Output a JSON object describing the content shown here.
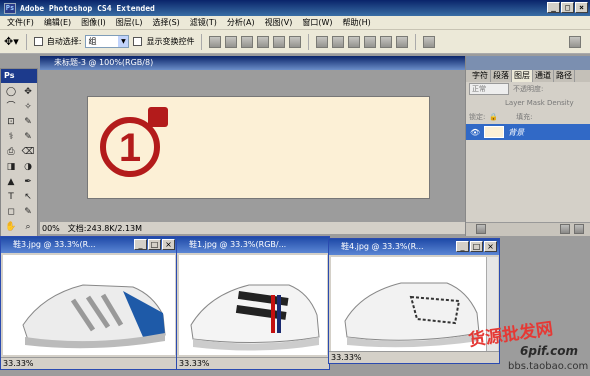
{
  "app": {
    "title": "Adobe Photoshop CS4 Extended",
    "ps_badge": "Ps"
  },
  "menu": [
    "文件(F)",
    "编辑(E)",
    "图像(I)",
    "图层(L)",
    "选择(S)",
    "滤镜(T)",
    "分析(A)",
    "视图(V)",
    "窗口(W)",
    "帮助(H)"
  ],
  "options": {
    "auto_select_label": "自动选择:",
    "auto_select_value": "组",
    "show_transform_label": "显示变换控件"
  },
  "tools": {
    "title": "Ps",
    "glyphs": [
      "◯",
      "✥",
      "⌒",
      "✧",
      "⊡",
      "✎",
      "⚕",
      "✎",
      "⎙",
      "⌫",
      "◨",
      "◑",
      "▲",
      "✒",
      "T",
      "↖",
      "◻",
      "✎",
      "✋",
      "⌕"
    ]
  },
  "main_doc": {
    "title": "未标题-3 @ 100%(RGB/8)",
    "zoom": "00%",
    "status": "文档:243.8K/2.13M",
    "logo_digit": "1"
  },
  "layers_panel": {
    "tabs": [
      "字符",
      "段落",
      "图层",
      "通道",
      "路径"
    ],
    "blend_mode": "正常",
    "opacity_label": "不透明度:",
    "mask_density_label": "Layer Mask Density",
    "lock_label": "锁定:",
    "fill_label": "填充:",
    "layer_name": "背景"
  },
  "windows": [
    {
      "title": "鞋3.jpg @ 33.3%(R...",
      "zoom": "33.33%"
    },
    {
      "title": "鞋1.jpg @ 33.3%(RGB/...",
      "zoom": "33.33%"
    },
    {
      "title": "鞋4.jpg @ 33.3%(R...",
      "zoom": "33.33%"
    }
  ],
  "watermark": {
    "cn": "货源批发网",
    "site": "6pif.com",
    "url": "bbs.taobao.com"
  },
  "colors": {
    "foreground": "#c41010",
    "canvas": "#fcf0d6",
    "accent": "#b31b1b"
  }
}
